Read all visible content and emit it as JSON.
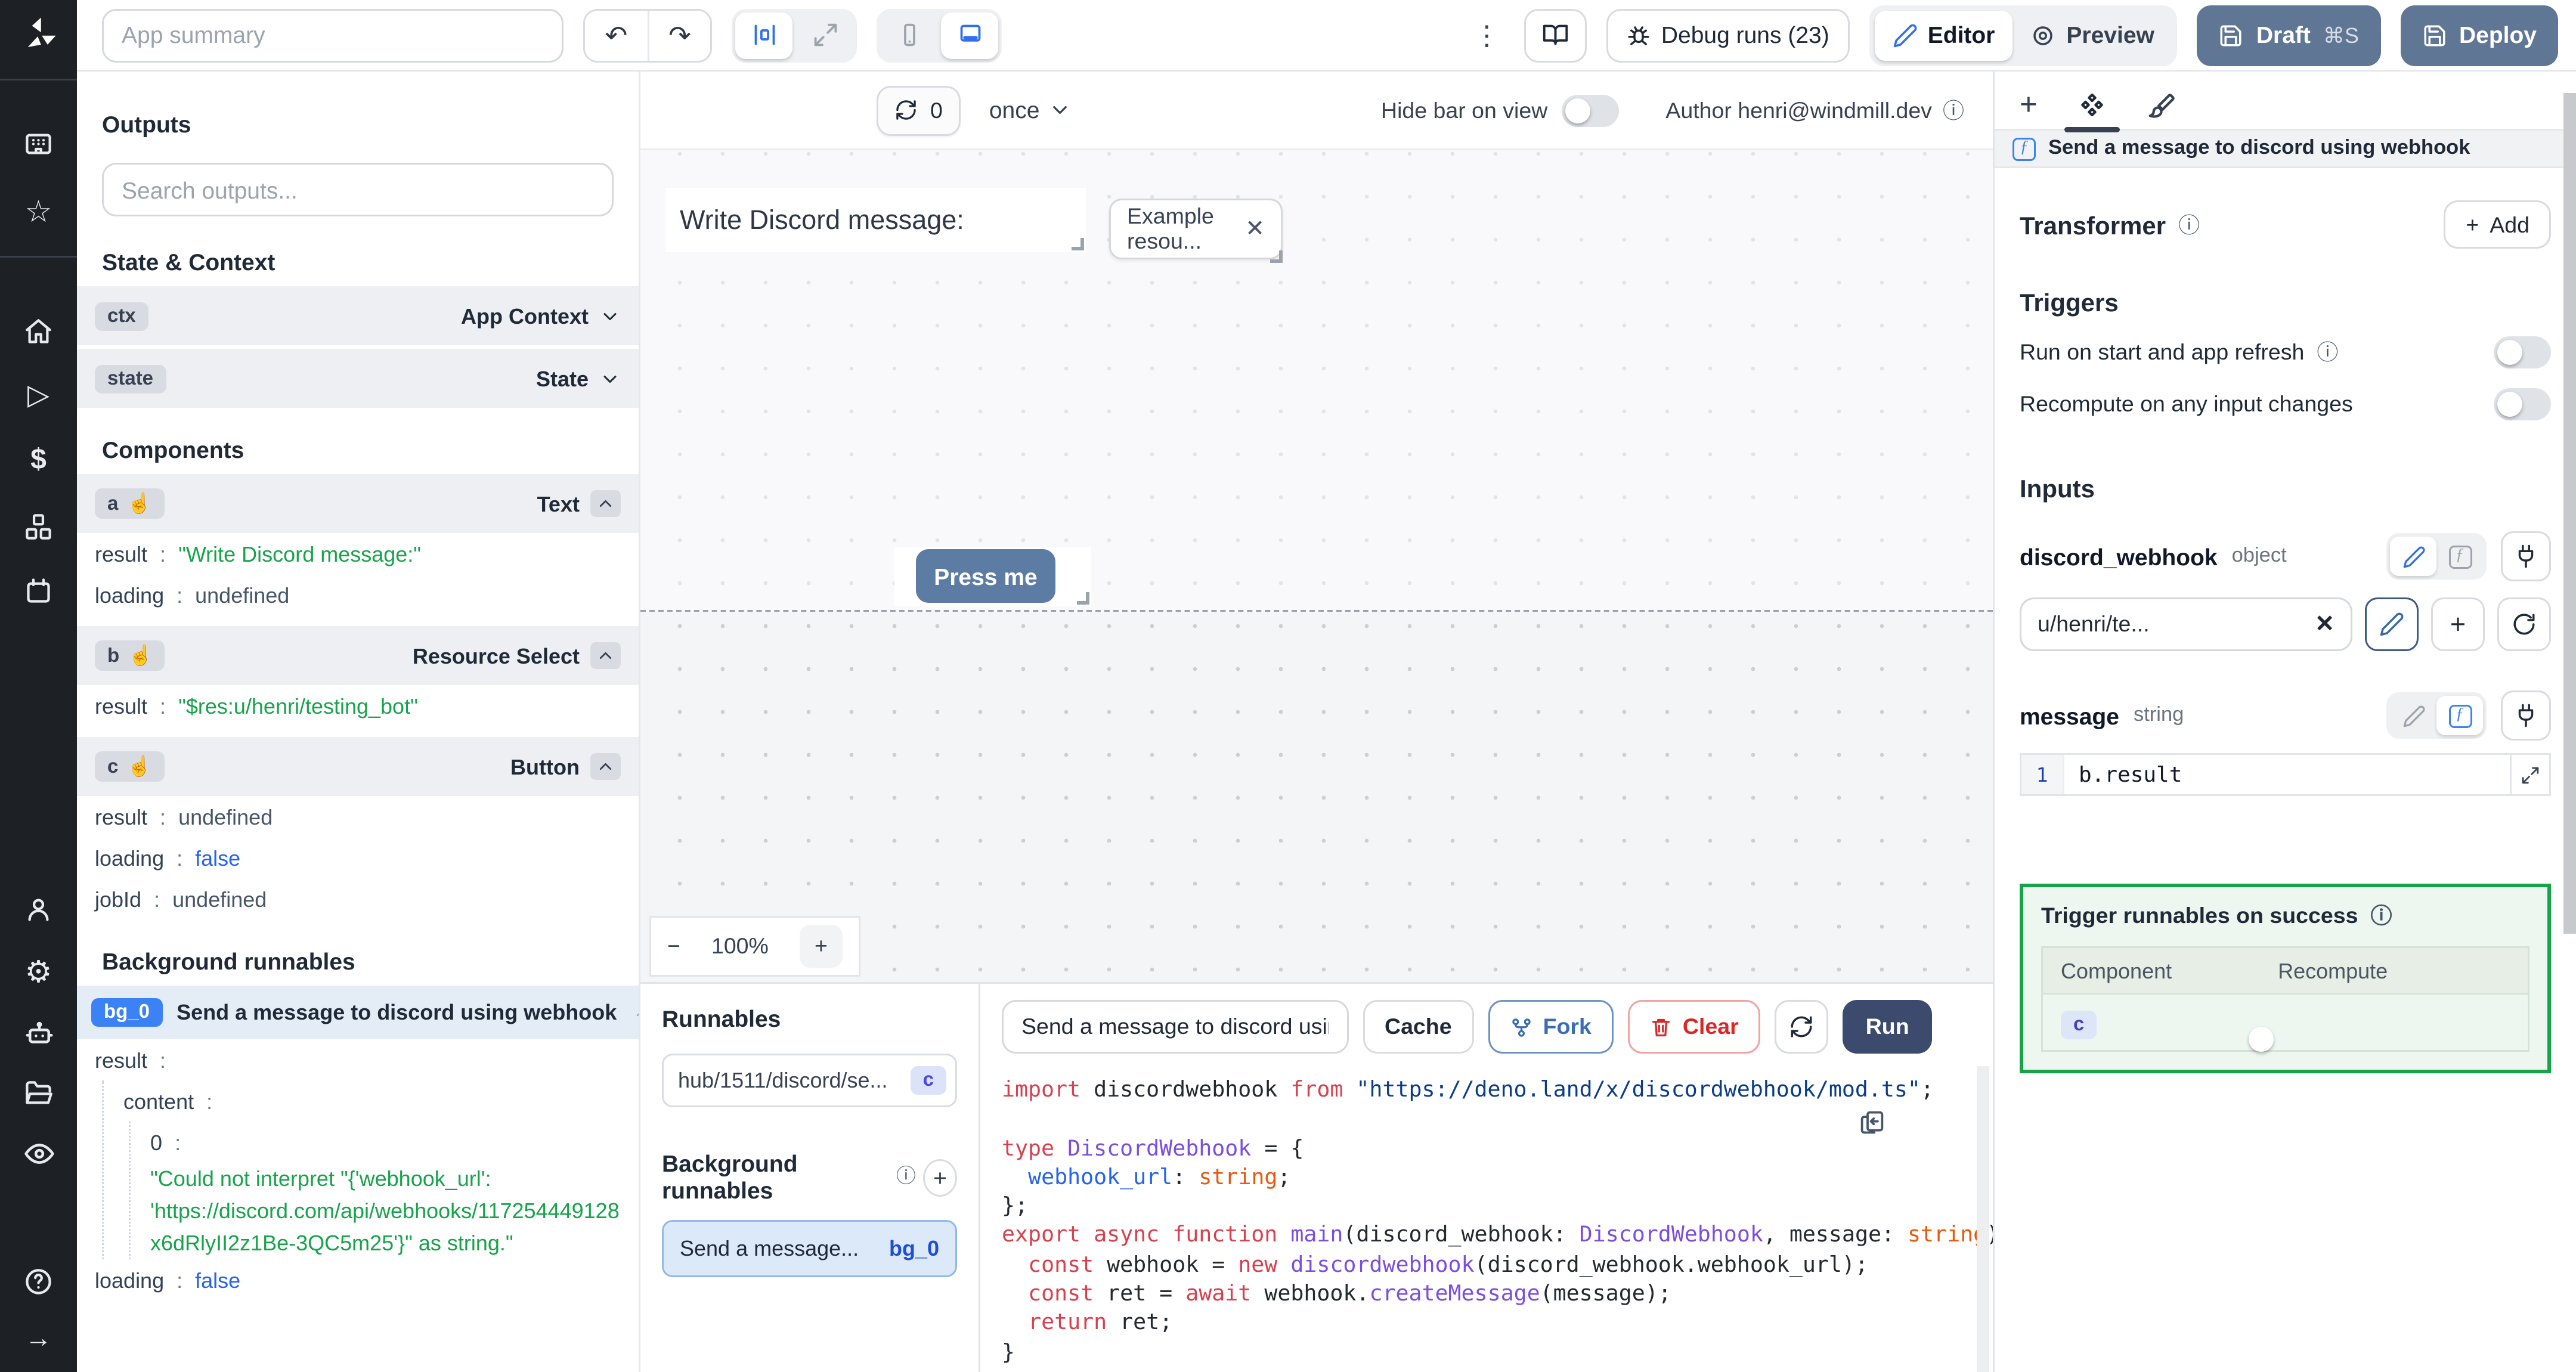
{
  "icons": {
    "kebab": "⋮",
    "undo": "↶",
    "redo": "↷",
    "close": "✕",
    "pointer": "☝",
    "info": "ⓘ",
    "plus": "+",
    "minus": "−",
    "arrow_right": "→",
    "dollar": "$",
    "star": "☆",
    "function_f": "ƒ",
    "play": "▷",
    "gear": "⚙",
    "question": "?"
  },
  "topbar": {
    "app_summary_placeholder": "App summary",
    "debug_runs_label": "Debug runs (23)",
    "editor_label": "Editor",
    "preview_label": "Preview",
    "draft_label": "Draft",
    "draft_shortcut": "⌘S",
    "deploy_label": "Deploy"
  },
  "outputs": {
    "title": "Outputs",
    "search_placeholder": "Search outputs...",
    "state_context_title": "State & Context",
    "ctx": {
      "id": "ctx",
      "type": "App Context"
    },
    "state": {
      "id": "state",
      "type": "State"
    },
    "components_title": "Components",
    "components": [
      {
        "id": "a",
        "type": "Text",
        "rows": [
          {
            "k": "result",
            "v": "\"Write Discord message:\""
          },
          {
            "k": "loading",
            "v": "undefined"
          }
        ]
      },
      {
        "id": "b",
        "type": "Resource Select",
        "rows": [
          {
            "k": "result",
            "v": "\"$res:u/henri/testing_bot\""
          }
        ]
      },
      {
        "id": "c",
        "type": "Button",
        "rows": [
          {
            "k": "result",
            "v": "undefined"
          },
          {
            "k": "loading",
            "v": "false"
          },
          {
            "k": "jobId",
            "v": "undefined"
          }
        ]
      }
    ],
    "bg_title": "Background runnables",
    "bg": {
      "badge": "bg_0",
      "label": "Send a message to discord using webhook",
      "result_key": "result",
      "content_key": "content",
      "index_key": "0",
      "value_lines": [
        "\"Could not interpret \"{'webhook_url':",
        "'https://discord.com/api/webhooks/117254449128",
        "x6dRlyII2z1Be-3QC5m25'}\" as string.\""
      ],
      "loading_key": "loading",
      "loading_value": "false"
    }
  },
  "canvas": {
    "refresh_count": "0",
    "frequency": "once",
    "hide_bar_label": "Hide bar on view",
    "author_label": "Author henri@windmill.dev",
    "text_component": "Write Discord message:",
    "select_value": "Example resou...",
    "button_label": "Press me",
    "zoom_level": "100%"
  },
  "runnables": {
    "title": "Runnables",
    "item_path": "hub/1511/discord/se...",
    "item_badge": "c",
    "bg_title": "Background runnables",
    "bg_item_label": "Send a message...",
    "bg_item_badge": "bg_0"
  },
  "editor": {
    "script_name": "Send a message to discord using",
    "cache_label": "Cache",
    "fork_label": "Fork",
    "clear_label": "Clear",
    "run_label": "Run",
    "code_lines": [
      [
        [
          "kw",
          "import"
        ],
        [
          "id",
          " discordwebhook "
        ],
        [
          "kw",
          "from"
        ],
        [
          "str",
          " \"https://deno.land/x/discordwebhook/mod.ts\""
        ],
        [
          "id",
          ";"
        ]
      ],
      [],
      [
        [
          "kw",
          "type"
        ],
        [
          "id",
          " "
        ],
        [
          "ty",
          "DiscordWebhook"
        ],
        [
          "id",
          " = {"
        ]
      ],
      [
        [
          "id",
          "  "
        ],
        [
          "pr",
          "webhook_url"
        ],
        [
          "id",
          ": "
        ],
        [
          "or",
          "string"
        ],
        [
          "id",
          ";"
        ]
      ],
      [
        [
          "id",
          "};"
        ]
      ],
      [
        [
          "kw",
          "export"
        ],
        [
          "id",
          " "
        ],
        [
          "kw",
          "async"
        ],
        [
          "id",
          " "
        ],
        [
          "kw",
          "function"
        ],
        [
          "id",
          " "
        ],
        [
          "ty",
          "main"
        ],
        [
          "id",
          "(discord_webhook: "
        ],
        [
          "ty",
          "DiscordWebhook"
        ],
        [
          "id",
          ", message: "
        ],
        [
          "or",
          "string"
        ],
        [
          "id",
          ") {"
        ]
      ],
      [
        [
          "id",
          "  "
        ],
        [
          "kw",
          "const"
        ],
        [
          "id",
          " webhook = "
        ],
        [
          "kw",
          "new"
        ],
        [
          "id",
          " "
        ],
        [
          "ty",
          "discordwebhook"
        ],
        [
          "id",
          "(discord_webhook.webhook_url);"
        ]
      ],
      [
        [
          "id",
          "  "
        ],
        [
          "kw",
          "const"
        ],
        [
          "id",
          " ret = "
        ],
        [
          "kw",
          "await"
        ],
        [
          "id",
          " webhook."
        ],
        [
          "ty",
          "createMessage"
        ],
        [
          "id",
          "(message);"
        ]
      ],
      [
        [
          "id",
          "  "
        ],
        [
          "kw",
          "return"
        ],
        [
          "id",
          " ret;"
        ]
      ],
      [
        [
          "id",
          "}"
        ]
      ]
    ]
  },
  "panel": {
    "header": "Send a message to discord using webhook",
    "transformer_label": "Transformer",
    "add_label": "Add",
    "triggers_label": "Triggers",
    "trigger1": "Run on start and app refresh",
    "trigger2": "Recompute on any input changes",
    "inputs_label": "Inputs",
    "field1": {
      "name": "discord_webhook",
      "type": "object",
      "value": "u/henri/te..."
    },
    "field2": {
      "name": "message",
      "type": "string",
      "line_no": "1",
      "expr": "b.result"
    },
    "success": {
      "title": "Trigger runnables on success",
      "col1": "Component",
      "col2": "Recompute",
      "row_component": "c"
    }
  },
  "colors": {
    "accent_blue": "#2f6fed",
    "run_button": "#3c4b6d",
    "draft_deploy_button": "#5f7795",
    "press_me_button": "#5c7ca3",
    "success_border": "#17a34a",
    "string_green": "#16a34a",
    "bool_blue": "#2563eb"
  }
}
